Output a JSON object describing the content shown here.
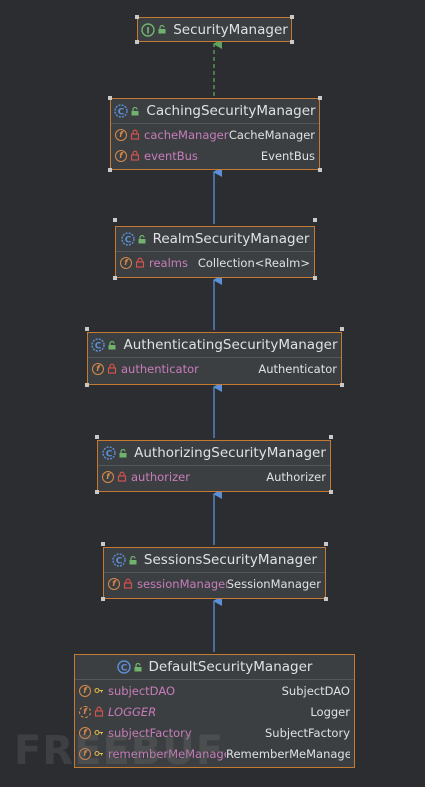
{
  "nodes": {
    "n0": {
      "title": "SecurityManager",
      "kind": "interface",
      "fields": []
    },
    "n1": {
      "title": "CachingSecurityManager",
      "kind": "abstract-class",
      "fields": [
        {
          "name": "cacheManager",
          "type": "CacheManager"
        },
        {
          "name": "eventBus",
          "type": "EventBus"
        }
      ]
    },
    "n2": {
      "title": "RealmSecurityManager",
      "kind": "abstract-class",
      "fields": [
        {
          "name": "realms",
          "type": "Collection<Realm>"
        }
      ]
    },
    "n3": {
      "title": "AuthenticatingSecurityManager",
      "kind": "abstract-class",
      "fields": [
        {
          "name": "authenticator",
          "type": "Authenticator"
        }
      ]
    },
    "n4": {
      "title": "AuthorizingSecurityManager",
      "kind": "abstract-class",
      "fields": [
        {
          "name": "authorizer",
          "type": "Authorizer"
        }
      ]
    },
    "n5": {
      "title": "SessionsSecurityManager",
      "kind": "abstract-class",
      "fields": [
        {
          "name": "sessionManager",
          "type": "SessionManager"
        }
      ]
    },
    "n6": {
      "title": "DefaultSecurityManager",
      "kind": "class",
      "fields": [
        {
          "name": "subjectDAO",
          "type": "SubjectDAO"
        },
        {
          "name": "LOGGER",
          "type": "Logger"
        },
        {
          "name": "subjectFactory",
          "type": "SubjectFactory"
        },
        {
          "name": "rememberMeManager",
          "type": "RememberMeManager"
        }
      ]
    }
  },
  "edges": [
    {
      "from": "CachingSecurityManager",
      "to": "SecurityManager",
      "relation": "implements"
    },
    {
      "from": "RealmSecurityManager",
      "to": "CachingSecurityManager",
      "relation": "extends"
    },
    {
      "from": "AuthenticatingSecurityManager",
      "to": "RealmSecurityManager",
      "relation": "extends"
    },
    {
      "from": "AuthorizingSecurityManager",
      "to": "AuthenticatingSecurityManager",
      "relation": "extends"
    },
    {
      "from": "SessionsSecurityManager",
      "to": "AuthorizingSecurityManager",
      "relation": "extends"
    },
    {
      "from": "DefaultSecurityManager",
      "to": "SessionsSecurityManager",
      "relation": "extends"
    }
  ],
  "colors": {
    "border": "#c57a33",
    "arrow": "#5b8fd6",
    "implements": "#5fa35f",
    "field_name": "#c77dbb"
  },
  "watermark": "FREEBUF"
}
